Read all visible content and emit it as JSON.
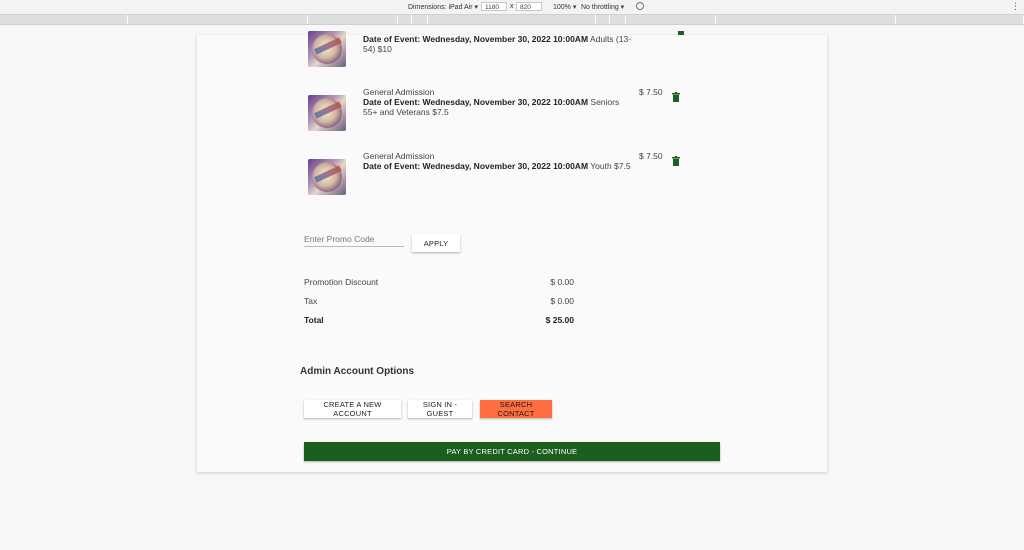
{
  "devtools": {
    "dimensions_label": "Dimensions: iPad Air ▾",
    "width": "1180",
    "times": "x",
    "height": "820",
    "zoom": "100% ▾",
    "throttle": "No throttling ▾"
  },
  "cart": {
    "items": [
      {
        "name": "",
        "date_prefix": "Date of Event: Wednesday, November 30, 2022 10:00AM",
        "detail": "Adults (13-54) $10",
        "price": ""
      },
      {
        "name": "General Admission",
        "date_prefix": "Date of Event: Wednesday, November 30, 2022 10:00AM",
        "detail": "Seniors 55+ and Veterans $7.5",
        "price": "$ 7.50"
      },
      {
        "name": "General Admission",
        "date_prefix": "Date of Event: Wednesday, November 30, 2022 10:00AM",
        "detail": "Youth $7.5",
        "price": "$ 7.50"
      }
    ]
  },
  "promo": {
    "placeholder": "Enter Promo Code",
    "apply_label": "APPLY"
  },
  "summary": {
    "discount_label": "Promotion Discount",
    "discount_value": "$ 0.00",
    "tax_label": "Tax",
    "tax_value": "$ 0.00",
    "total_label": "Total",
    "total_value": "$ 25.00"
  },
  "admin": {
    "title": "Admin Account Options",
    "create_label": "CREATE A NEW ACCOUNT",
    "signin_label": "SIGN IN - GUEST",
    "search_label": "SEARCH CONTACT"
  },
  "pay_label": "PAY BY CREDIT CARD - CONTINUE",
  "colors": {
    "search_button": "#ff6e40",
    "pay_button": "#1b5e20",
    "trash_icon": "#1b5e20"
  }
}
